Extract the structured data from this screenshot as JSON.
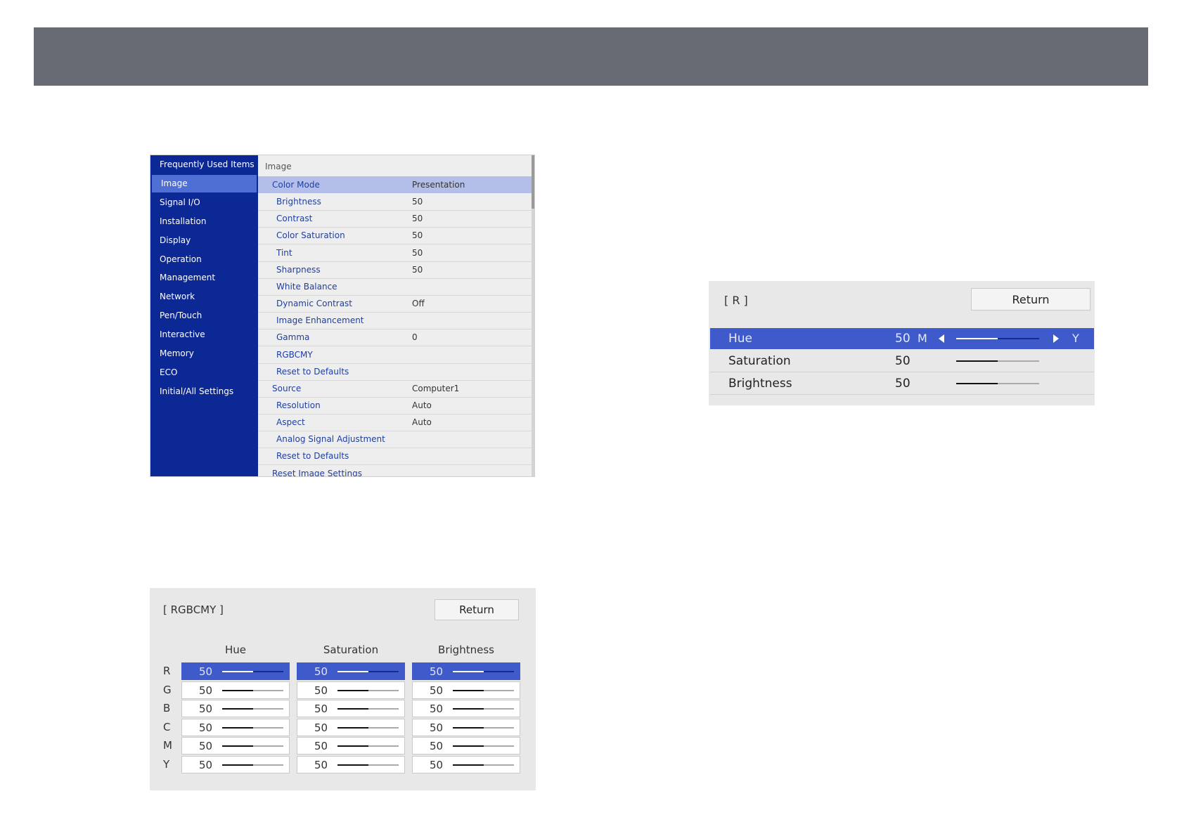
{
  "menu": {
    "sidebar": [
      {
        "label": "Frequently Used Items",
        "active": false
      },
      {
        "label": "Image",
        "active": true
      },
      {
        "label": "Signal I/O",
        "active": false
      },
      {
        "label": "Installation",
        "active": false
      },
      {
        "label": "Display",
        "active": false
      },
      {
        "label": "Operation",
        "active": false
      },
      {
        "label": "Management",
        "active": false
      },
      {
        "label": "Network",
        "active": false
      },
      {
        "label": "Pen/Touch",
        "active": false
      },
      {
        "label": "Interactive",
        "active": false
      },
      {
        "label": "Memory",
        "active": false
      },
      {
        "label": "ECO",
        "active": false
      },
      {
        "label": "Initial/All Settings",
        "active": false
      }
    ],
    "heading": "Image",
    "rows": [
      {
        "label": "Color Mode",
        "value": "Presentation",
        "selected": true,
        "sub": false
      },
      {
        "label": "Brightness",
        "value": "50",
        "selected": false,
        "sub": true
      },
      {
        "label": "Contrast",
        "value": "50",
        "selected": false,
        "sub": true
      },
      {
        "label": "Color Saturation",
        "value": "50",
        "selected": false,
        "sub": true
      },
      {
        "label": "Tint",
        "value": "50",
        "selected": false,
        "sub": true
      },
      {
        "label": "Sharpness",
        "value": "50",
        "selected": false,
        "sub": true
      },
      {
        "label": "White Balance",
        "value": "",
        "selected": false,
        "sub": true
      },
      {
        "label": "Dynamic Contrast",
        "value": "Off",
        "selected": false,
        "sub": true
      },
      {
        "label": "Image Enhancement",
        "value": "",
        "selected": false,
        "sub": true
      },
      {
        "label": "Gamma",
        "value": "0",
        "selected": false,
        "sub": true
      },
      {
        "label": "RGBCMY",
        "value": "",
        "selected": false,
        "sub": true
      },
      {
        "label": "Reset to Defaults",
        "value": "",
        "selected": false,
        "sub": true
      },
      {
        "label": "Source",
        "value": "Computer1",
        "selected": false,
        "sub": false
      },
      {
        "label": "Resolution",
        "value": "Auto",
        "selected": false,
        "sub": true
      },
      {
        "label": "Aspect",
        "value": "Auto",
        "selected": false,
        "sub": true
      },
      {
        "label": "Analog Signal Adjustment",
        "value": "",
        "selected": false,
        "sub": true
      },
      {
        "label": "Reset to Defaults",
        "value": "",
        "selected": false,
        "sub": true
      },
      {
        "label": "Reset Image Settings",
        "value": "",
        "selected": false,
        "sub": false
      }
    ]
  },
  "rgbcmy": {
    "title": "[ RGBCMY ]",
    "return_label": "Return",
    "columns": [
      "Hue",
      "Saturation",
      "Brightness"
    ],
    "rows": [
      {
        "label": "R",
        "values": [
          "50",
          "50",
          "50"
        ],
        "level": 0.5,
        "selected": true
      },
      {
        "label": "G",
        "values": [
          "50",
          "50",
          "50"
        ],
        "level": 0.5,
        "selected": false
      },
      {
        "label": "B",
        "values": [
          "50",
          "50",
          "50"
        ],
        "level": 0.5,
        "selected": false
      },
      {
        "label": "C",
        "values": [
          "50",
          "50",
          "50"
        ],
        "level": 0.5,
        "selected": false
      },
      {
        "label": "M",
        "values": [
          "50",
          "50",
          "50"
        ],
        "level": 0.5,
        "selected": false
      },
      {
        "label": "Y",
        "values": [
          "50",
          "50",
          "50"
        ],
        "level": 0.5,
        "selected": false
      }
    ]
  },
  "r_panel": {
    "title": "[ R ]",
    "return_label": "Return",
    "rows": [
      {
        "label": "Hue",
        "value": "50",
        "level": 0.5,
        "selected": true,
        "left_end": "M",
        "right_end": "Y"
      },
      {
        "label": "Saturation",
        "value": "50",
        "level": 0.5,
        "selected": false
      },
      {
        "label": "Brightness",
        "value": "50",
        "level": 0.5,
        "selected": false
      }
    ]
  },
  "colors": {
    "banner": "#686b73",
    "menu_sidebar": "#0c2894",
    "selection": "#3f5bcb"
  }
}
